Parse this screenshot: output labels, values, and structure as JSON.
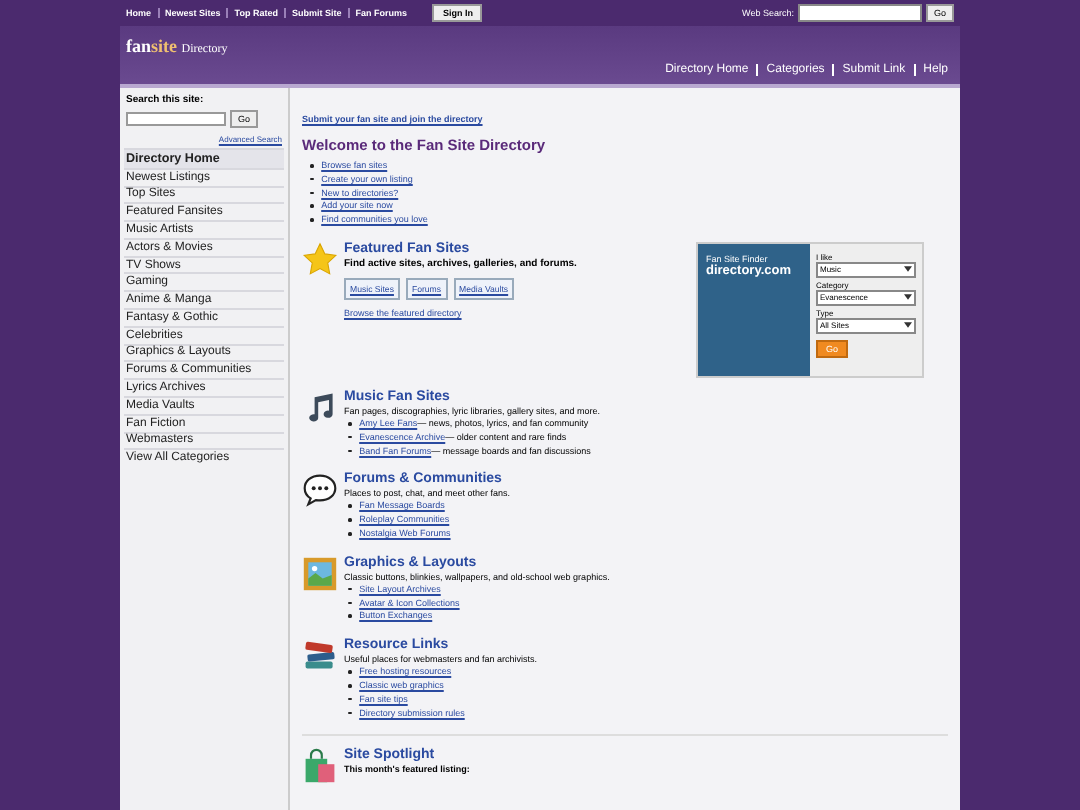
{
  "top_nav": {
    "links": [
      "Home",
      "Newest Sites",
      "Top Rated",
      "Submit Site",
      "Fan Forums"
    ],
    "sign_in": "Sign In",
    "search_label": "Web Search:",
    "search_button": "Go"
  },
  "header": {
    "logo_bold": "fan",
    "logo_accent": "site",
    "logo_rest": "Directory",
    "nav": [
      "Directory Home",
      "Categories",
      "Submit Link",
      "Help"
    ]
  },
  "sidebar": {
    "search_title": "Search this site:",
    "search_button": "Go",
    "advanced": "Advanced Search",
    "items": [
      {
        "label": "Directory Home",
        "selected": true
      },
      {
        "label": "Newest Listings",
        "selected": false
      },
      {
        "label": "Top Sites",
        "selected": false
      },
      {
        "label": "Featured Fansites",
        "selected": false
      },
      {
        "label": "Music Artists",
        "selected": false
      },
      {
        "label": "Actors & Movies",
        "selected": false
      },
      {
        "label": "TV Shows",
        "selected": false
      },
      {
        "label": "Gaming",
        "selected": false
      },
      {
        "label": "Anime & Manga",
        "selected": false
      },
      {
        "label": "Fantasy & Gothic",
        "selected": false
      },
      {
        "label": "Celebrities",
        "selected": false
      },
      {
        "label": "Graphics & Layouts",
        "selected": false
      },
      {
        "label": "Forums & Communities",
        "selected": false
      },
      {
        "label": "Lyrics Archives",
        "selected": false
      },
      {
        "label": "Media Vaults",
        "selected": false
      },
      {
        "label": "Fan Fiction",
        "selected": false
      },
      {
        "label": "Webmasters",
        "selected": false
      },
      {
        "label": "View All Categories",
        "selected": false
      }
    ]
  },
  "main": {
    "submit_link": "Submit your fan site and join the directory",
    "title": "Welcome to the Fan Site Directory",
    "quick_links": [
      "Browse fan sites",
      "Create your own listing",
      "New to directories?",
      "Add your site now",
      "Find communities you love"
    ],
    "featured": {
      "title": "Featured Fan Sites",
      "text": "Find active sites, archives, galleries, and forums.",
      "buttons": [
        "Music Sites",
        "Forums",
        "Media Vaults"
      ],
      "link": "Browse the featured directory"
    },
    "finder": {
      "title": "Fan Site Finder",
      "domain": "directory.com",
      "fields": [
        {
          "label": "I like",
          "value": "Music"
        },
        {
          "label": "Category",
          "value": "Evanescence"
        },
        {
          "label": "Type",
          "value": "All Sites"
        }
      ],
      "button": "Go"
    },
    "sections": [
      {
        "kind": "music",
        "title": "Music Fan Sites",
        "text": "Fan pages, discographies, lyric libraries, gallery sites, and more.",
        "links": [
          {
            "link": "Amy Lee Fans",
            "note": "— news, photos, lyrics, and fan community"
          },
          {
            "link": "Evanescence Archive",
            "note": "— older content and rare finds"
          },
          {
            "link": "Band Fan Forums",
            "note": "— message boards and fan discussions"
          }
        ]
      },
      {
        "kind": "chat",
        "title": "Forums & Communities",
        "text": "Places to post, chat, and meet other fans.",
        "links": [
          {
            "link": "Fan Message Boards"
          },
          {
            "link": "Roleplay Communities"
          },
          {
            "link": "Nostalgia Web Forums"
          }
        ]
      },
      {
        "kind": "picture",
        "title": "Graphics & Layouts",
        "text": "Classic buttons, blinkies, wallpapers, and old-school web graphics.",
        "links": [
          {
            "link": "Site Layout Archives"
          },
          {
            "link": "Avatar & Icon Collections"
          },
          {
            "link": "Button Exchanges"
          }
        ]
      },
      {
        "kind": "books",
        "title": "Resource Links",
        "text": "Useful places for webmasters and fan archivists.",
        "links": [
          {
            "link": "Free hosting resources"
          },
          {
            "link": "Classic web graphics"
          },
          {
            "link": "Fan site tips"
          },
          {
            "link": "Directory submission rules"
          }
        ]
      }
    ],
    "spotlight": {
      "title": "Site Spotlight",
      "text": "This month's featured listing:"
    }
  }
}
